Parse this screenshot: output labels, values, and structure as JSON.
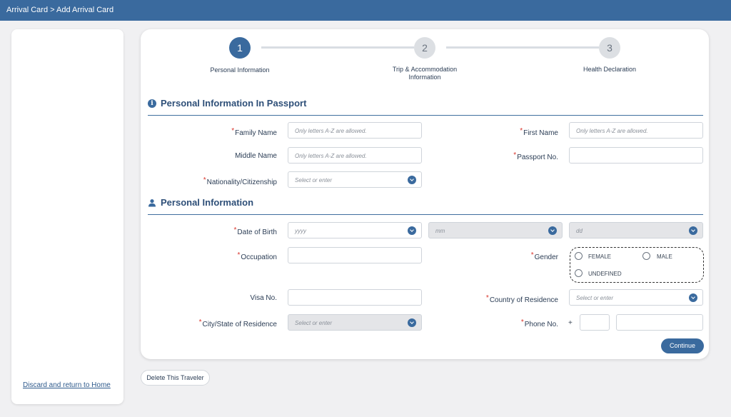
{
  "header": {
    "breadcrumb": "Arrival Card > Add Arrival Card"
  },
  "sidebar": {
    "discard_link": "Discard and return to Home"
  },
  "steps": [
    {
      "number": "1",
      "label": "Personal Information",
      "state": "active"
    },
    {
      "number": "2",
      "label": "Trip & Accommodation Information",
      "state": "inactive"
    },
    {
      "number": "3",
      "label": "Health Declaration",
      "state": "inactive"
    }
  ],
  "passport_section": {
    "title": "Personal Information In Passport",
    "icon": "info-icon",
    "family_name": {
      "label": "Family Name",
      "required": "*",
      "placeholder": "Only letters A-Z are allowed.",
      "value": ""
    },
    "first_name": {
      "label": "First Name",
      "required": "*",
      "placeholder": "Only letters A-Z are allowed.",
      "value": ""
    },
    "middle_name": {
      "label": "Middle Name",
      "placeholder": "Only letters A-Z are allowed.",
      "value": ""
    },
    "passport_no": {
      "label": "Passport No.",
      "required": "*",
      "value": ""
    },
    "nationality": {
      "label": "Nationality/Citizenship",
      "required": "*",
      "placeholder": "Select or enter"
    }
  },
  "personal_section": {
    "title": "Personal Information",
    "icon": "person-icon",
    "date_of_birth": {
      "label": "Date of Birth",
      "required": "*",
      "year_placeholder": "yyyy",
      "month_placeholder": "mm",
      "day_placeholder": "dd"
    },
    "occupation": {
      "label": "Occupation",
      "required": "*",
      "value": ""
    },
    "gender": {
      "label": "Gender",
      "required": "*",
      "options": [
        "FEMALE",
        "MALE",
        "UNDEFINED"
      ]
    },
    "visa_no": {
      "label": "Visa No.",
      "value": ""
    },
    "country_of_residence": {
      "label": "Country of Residence",
      "required": "*",
      "placeholder": "Select or enter"
    },
    "city_state": {
      "label": "City/State of Residence",
      "required": "*",
      "placeholder": "Select or enter"
    },
    "phone": {
      "label": "Phone No.",
      "required": "*",
      "prefix": "+",
      "code": "",
      "number": ""
    }
  },
  "actions": {
    "continue": "Continue",
    "delete_traveler": "Delete This Traveler"
  },
  "colors": {
    "accent": "#3a6a9e",
    "required": "#d9342b",
    "header": "#3a6a9e"
  }
}
